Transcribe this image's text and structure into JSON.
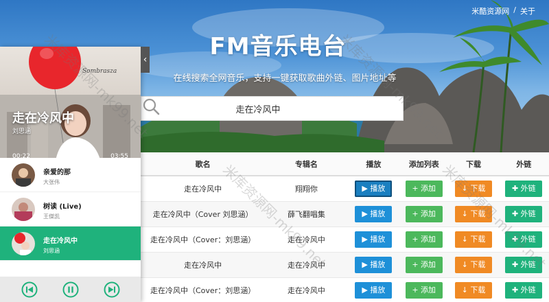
{
  "topnav": {
    "site_link": "米酷资源网",
    "separator": "/",
    "about_link": "关于"
  },
  "hero": {
    "title": "FM音乐电台",
    "subtitle": "在线搜索全网音乐，支持一键获取歌曲外链、图片地址等"
  },
  "search": {
    "value": "走在冷风中",
    "placeholder": "",
    "icon": "search-icon"
  },
  "table": {
    "headers": [
      "歌名",
      "专辑名",
      "播放",
      "添加列表",
      "下载",
      "外链"
    ],
    "buttons": {
      "play": "▶ 播放",
      "add": "+ 添加",
      "download": "↓ 下载",
      "link": "✚ 外链"
    },
    "rows": [
      {
        "song": "走在冷风中",
        "album": "翔翔你"
      },
      {
        "song": "走在冷风中（Cover 刘思涵）",
        "album": "薛飞翻唱集"
      },
      {
        "song": "走在冷风中（Cover：刘思涵）",
        "album": "走在冷风中"
      },
      {
        "song": "走在冷风中",
        "album": "走在冷风中"
      },
      {
        "song": "走在冷风中（Cover：刘思涵）",
        "album": "走在冷风中"
      }
    ]
  },
  "player": {
    "now_playing": {
      "title": "走在冷风中",
      "artist": "刘思涵",
      "time_elapsed": "00:22",
      "time_total": "03:55",
      "progress": 0.09
    },
    "playlist": [
      {
        "name": "亲爱的那",
        "artist": "大张伟"
      },
      {
        "name": "树读 (Live)",
        "artist": "王傑凯"
      },
      {
        "name": "走在冷风中",
        "artist": "刘思涵",
        "active": true
      }
    ],
    "accent": "#1fb27c"
  },
  "watermark": "米库资源网-mk99.net"
}
